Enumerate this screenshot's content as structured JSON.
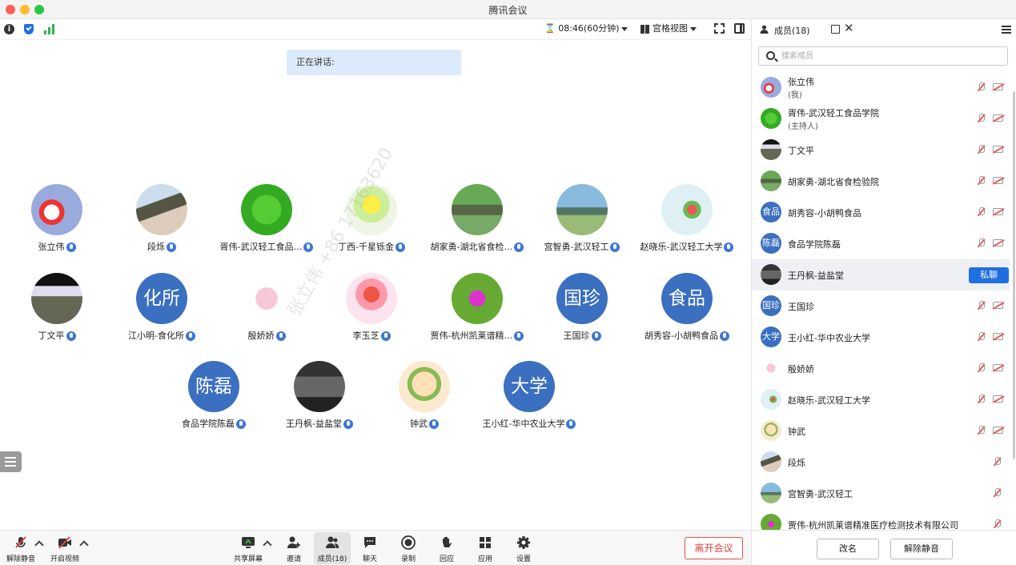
{
  "window": {
    "title": "腾讯会议"
  },
  "topbar": {
    "timer": "08:46(60分钟)",
    "view_mode": "宫格视图"
  },
  "speaking": {
    "label": "正在讲话:"
  },
  "watermark": "张立伟 +86 17163620",
  "tiles": [
    {
      "name": "张立伟",
      "avatar_text": ""
    },
    {
      "name": "段烁",
      "avatar_text": ""
    },
    {
      "name": "胥伟-武汉轻工食品…",
      "avatar_text": ""
    },
    {
      "name": "丁西-千星铄金",
      "avatar_text": ""
    },
    {
      "name": "胡家勇-湖北省食检…",
      "avatar_text": ""
    },
    {
      "name": "宫智勇-武汉轻工",
      "avatar_text": ""
    },
    {
      "name": "赵晓乐-武汉轻工大学",
      "avatar_text": ""
    },
    {
      "name": "丁文平",
      "avatar_text": ""
    },
    {
      "name": "江小明-食化所",
      "avatar_text": "化所"
    },
    {
      "name": "殷娇娇",
      "avatar_text": ""
    },
    {
      "name": "李玉芝",
      "avatar_text": ""
    },
    {
      "name": "贾伟-杭州凯莱谱精…",
      "avatar_text": ""
    },
    {
      "name": "王国珍",
      "avatar_text": "国珍"
    },
    {
      "name": "胡秀容-小胡鸭食品",
      "avatar_text": "食品"
    },
    {
      "name": "食品学院陈磊",
      "avatar_text": "陈磊"
    },
    {
      "name": "王丹枫-益盐堂",
      "avatar_text": ""
    },
    {
      "name": "钟武",
      "avatar_text": ""
    },
    {
      "name": "王小红-华中农业大学",
      "avatar_text": "大学"
    }
  ],
  "toolbar": {
    "unmute": "解除静音",
    "start_video": "开启视频",
    "share_screen": "共享屏幕",
    "invite": "邀请",
    "members": "成员(18)",
    "chat": "聊天",
    "record": "录制",
    "react": "回应",
    "apps": "应用",
    "settings": "设置",
    "leave": "离开会议"
  },
  "panel": {
    "title": "成员(18)",
    "search_placeholder": "搜索成员",
    "private_chat": "私聊",
    "rename": "改名",
    "unmute_all": "解除静音",
    "members": [
      {
        "name": "张立伟",
        "sub": "(我)",
        "avatar_text": ""
      },
      {
        "name": "胥伟-武汉轻工食品学院",
        "sub": "(主持人)",
        "avatar_text": ""
      },
      {
        "name": "丁文平",
        "sub": "",
        "avatar_text": ""
      },
      {
        "name": "胡家勇-湖北省食检验院",
        "sub": "",
        "avatar_text": ""
      },
      {
        "name": "胡秀容-小胡鸭食品",
        "sub": "",
        "avatar_text": "食品"
      },
      {
        "name": "食品学院陈磊",
        "sub": "",
        "avatar_text": "陈磊"
      },
      {
        "name": "王丹枫-益盐堂",
        "sub": "",
        "avatar_text": ""
      },
      {
        "name": "王国珍",
        "sub": "",
        "avatar_text": "国珍"
      },
      {
        "name": "王小红-华中农业大学",
        "sub": "",
        "avatar_text": "大学"
      },
      {
        "name": "殷娇娇",
        "sub": "",
        "avatar_text": ""
      },
      {
        "name": "赵晓乐-武汉轻工大学",
        "sub": "",
        "avatar_text": ""
      },
      {
        "name": "钟武",
        "sub": "",
        "avatar_text": ""
      },
      {
        "name": "段烁",
        "sub": "",
        "avatar_text": ""
      },
      {
        "name": "宫智勇-武汉轻工",
        "sub": "",
        "avatar_text": ""
      },
      {
        "name": "贾伟-杭州凯莱谱精准医疗检测技术有限公司",
        "sub": "",
        "avatar_text": ""
      }
    ]
  },
  "colors": {
    "accent": "#1f6fe0",
    "avatar_blue": "#3b6fbf",
    "leave_red": "#e04040"
  }
}
